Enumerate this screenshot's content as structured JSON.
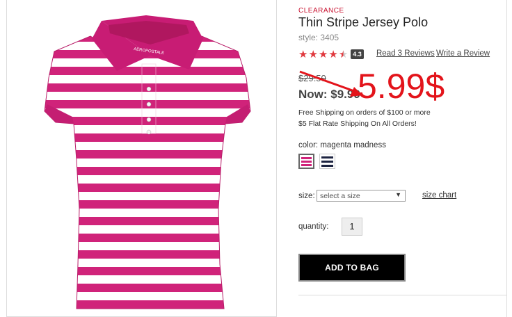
{
  "product": {
    "badge": "CLEARANCE",
    "title": "Thin Stripe Jersey Polo",
    "style": "style: 3405",
    "rating": "4.3",
    "rating_stars": 4.3,
    "read_reviews": "Read 3 Reviews",
    "write_review": "Write a Review",
    "was_price": "$29.50",
    "now_price": "Now: $9.99",
    "annotation": "5.99$",
    "shipping_line1": "Free Shipping on orders of $100 or more",
    "shipping_line2": "$5 Flat Rate Shipping On All Orders!",
    "color_label": "color:",
    "color_value": "magenta madness",
    "size_label": "size:",
    "size_placeholder": "select a size",
    "size_chart": "size chart",
    "quantity_label": "quantity:",
    "quantity_value": "1",
    "add_to_bag": "ADD TO BAG",
    "collar_brand": "AEROPOSTALE"
  },
  "colors": {
    "accent_red": "#c8102e",
    "magenta": "#d0237a",
    "navy": "#1c2340",
    "annotation_red": "#e3141b"
  }
}
